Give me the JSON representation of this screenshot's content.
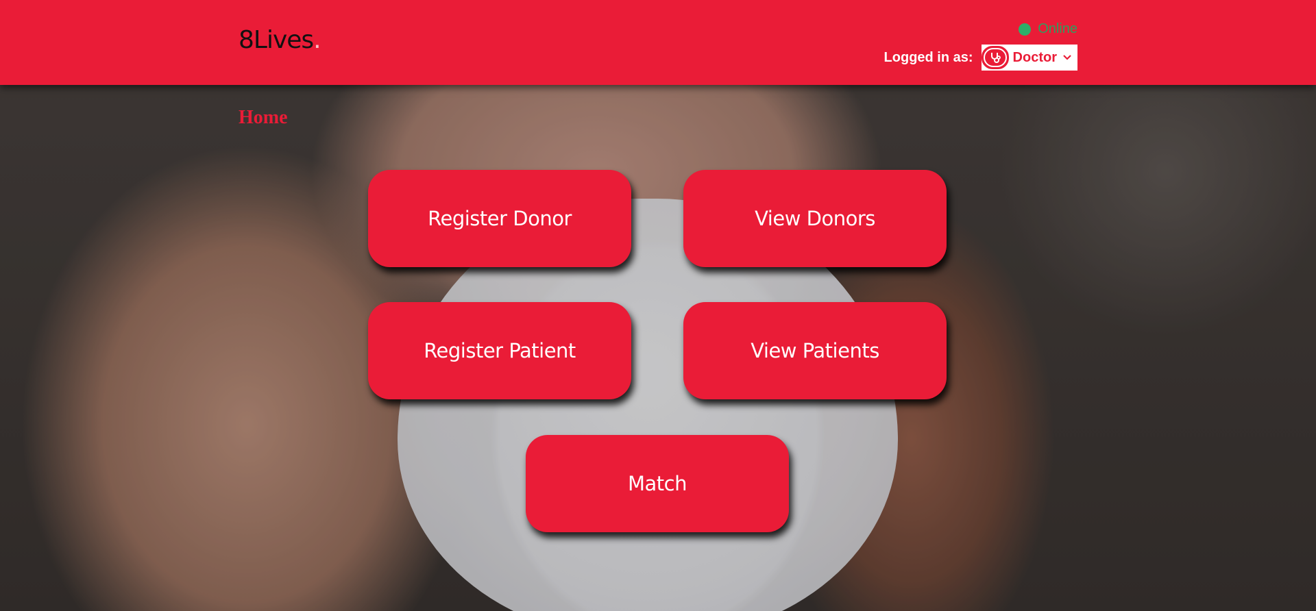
{
  "header": {
    "logo_text": "8Lives",
    "logo_dot": ".",
    "status": {
      "label": "Online",
      "color": "#2eae69"
    },
    "login": {
      "label": "Logged in as:",
      "role_icon": "stethoscope-icon",
      "role_value": "Doctor",
      "chevron_icon": "chevron-down-icon"
    }
  },
  "main": {
    "title": "Home",
    "buttons": {
      "register_donor": "Register Donor",
      "view_donors": "View Donors",
      "register_patient": "Register Patient",
      "view_patients": "View Patients",
      "match": "Match"
    }
  },
  "colors": {
    "brand": "#ea1c37",
    "text_on_brand": "#ffffff",
    "logo_text": "#111111"
  }
}
